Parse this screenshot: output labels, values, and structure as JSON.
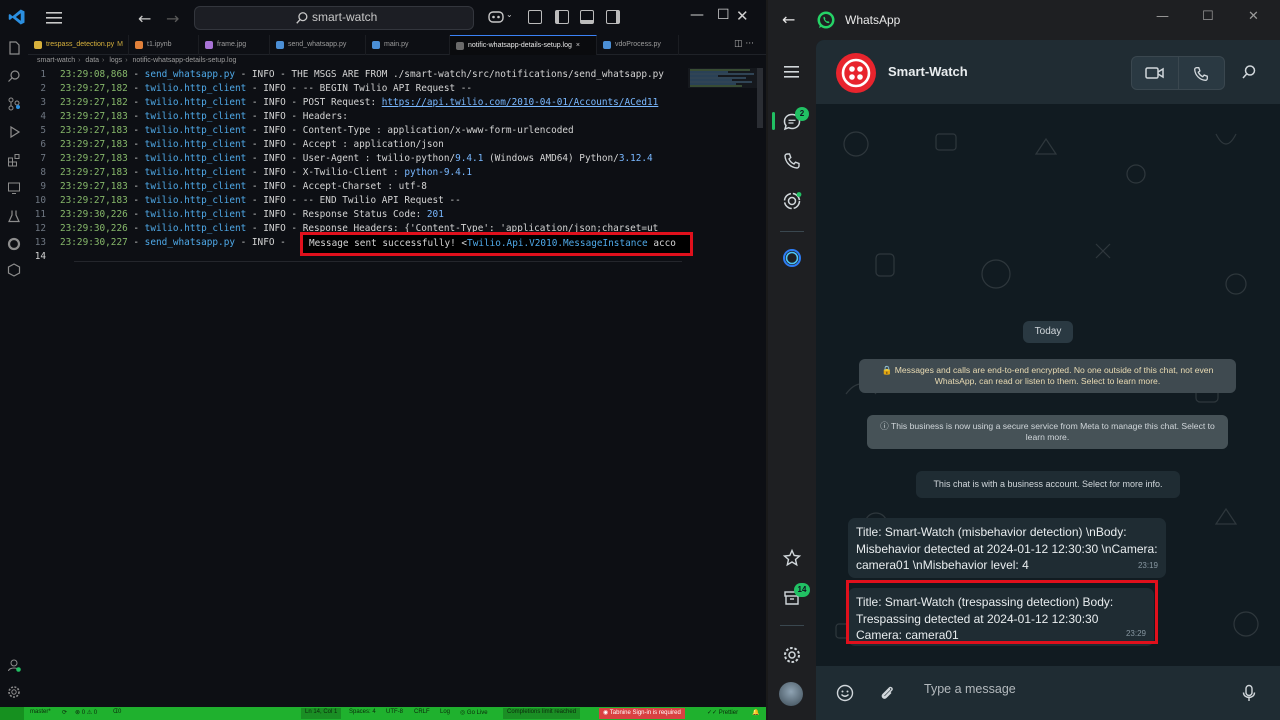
{
  "vscode": {
    "search_text": "smart-watch",
    "tabs": [
      {
        "label": "trespass_detection.py",
        "modified": "M",
        "color": "#d8b13c",
        "active": false
      },
      {
        "label": "t1.ipynb",
        "color": "#e0803a",
        "active": false
      },
      {
        "label": "frame.jpg",
        "color": "#a873d6",
        "active": false
      },
      {
        "label": "send_whatsapp.py",
        "color": "#4b8fd6",
        "active": false
      },
      {
        "label": "main.py",
        "color": "#4b8fd6",
        "active": false
      },
      {
        "label": "notific-whatsapp-details-setup.log",
        "close": "×",
        "color": "#6a6a6a",
        "active": true
      },
      {
        "label": "vdoProcess.py",
        "color": "#4b8fd6",
        "active": false
      }
    ],
    "breadcrumb": [
      "smart-watch",
      "data",
      "logs",
      "notific-whatsapp-details-setup.log"
    ],
    "code_lines": [
      {
        "n": "1",
        "time": "23:29:08,868",
        "module": "send_whatsapp.py",
        "rest": " - INFO - THE MSGS ARE FROM ./smart-watch/src/notifications/send_whatsapp.py"
      },
      {
        "n": "2",
        "time": "23:29:27,182",
        "module": "twilio.http_client",
        "rest": " - INFO - -- BEGIN Twilio API Request --"
      },
      {
        "n": "3",
        "time": "23:29:27,182",
        "module": "twilio.http_client",
        "rest": " - INFO - POST Request: ",
        "url": "https://api.twilio.com/2010-04-01/Accounts/ACed11"
      },
      {
        "n": "4",
        "time": "23:29:27,183",
        "module": "twilio.http_client",
        "rest": " - INFO - Headers:"
      },
      {
        "n": "5",
        "time": "23:29:27,183",
        "module": "twilio.http_client",
        "rest": " - INFO - Content-Type : application/x-www-form-urlencoded"
      },
      {
        "n": "6",
        "time": "23:29:27,183",
        "module": "twilio.http_client",
        "rest": " - INFO - Accept : application/json"
      },
      {
        "n": "7",
        "time": "23:29:27,183",
        "module": "twilio.http_client",
        "rest": " - INFO - User-Agent : twilio-python/",
        "v1": "9.4.1",
        "rest2": " (Windows AMD64) Python/",
        "v2": "3.12.4"
      },
      {
        "n": "8",
        "time": "23:29:27,183",
        "module": "twilio.http_client",
        "rest": " - INFO - X-Twilio-Client : ",
        "v1": "python-9.4.1"
      },
      {
        "n": "9",
        "time": "23:29:27,183",
        "module": "twilio.http_client",
        "rest": " - INFO - Accept-Charset : utf-8"
      },
      {
        "n": "10",
        "time": "23:29:27,183",
        "module": "twilio.http_client",
        "rest": " - INFO - -- END Twilio API Request --"
      },
      {
        "n": "11",
        "time": "23:29:30,226",
        "module": "twilio.http_client",
        "rest": " - INFO - Response Status Code: ",
        "v1": "201"
      },
      {
        "n": "12",
        "time": "23:29:30,226",
        "module": "twilio.http_client",
        "rest": " - INFO - Response Headers: {'Content-Type': 'application/json;charset=ut"
      },
      {
        "n": "13",
        "time": "23:29:30,227",
        "module": "send_whatsapp.py",
        "rest": " - INFO - "
      },
      {
        "n": "14"
      }
    ],
    "highlight": {
      "text": "Message sent successfully! <",
      "link": "Twilio.Api.V2010.MessageInstance",
      "tail": " acco"
    },
    "status": {
      "branch": "master*",
      "errors": "⊗ 0 ⚠ 0",
      "ports": "0",
      "position": "Ln 14, Col 1",
      "spaces": "Spaces: 4",
      "encoding": "UTF-8",
      "eol": "CRLF",
      "language": "Log",
      "golive": "Go Live",
      "completions": "Completions limit reached",
      "tabnine": "Tabnine Sign-in is required",
      "prettier": "Prettier"
    }
  },
  "whatsapp": {
    "app_title": "WhatsApp",
    "contact_name": "Smart-Watch",
    "badges": {
      "chats": "2",
      "archived": "14"
    },
    "date_chip": "Today",
    "sys_encrypted": "🔒 Messages and calls are end-to-end encrypted. No one outside of this chat, not even WhatsApp, can read or listen to them. Select to learn more.",
    "sys_meta": "ⓘ This business is now using a secure service from Meta to manage this chat. Select to learn more.",
    "sys_business": "This chat is with a business account. Select for more info.",
    "messages": [
      {
        "text": "Title: Smart-Watch (misbehavior detection) \\nBody: Misbehavior detected at 2024-01-12 12:30:30 \\nCamera: camera01 \\nMisbehavior level: 4",
        "time": "23:19"
      },
      {
        "text": "Title: Smart-Watch (trespassing detection) Body: Trespassing detected at 2024-01-12 12:30:30 Camera: camera01",
        "time": "23:29"
      }
    ],
    "composer_placeholder": "Type a message"
  }
}
